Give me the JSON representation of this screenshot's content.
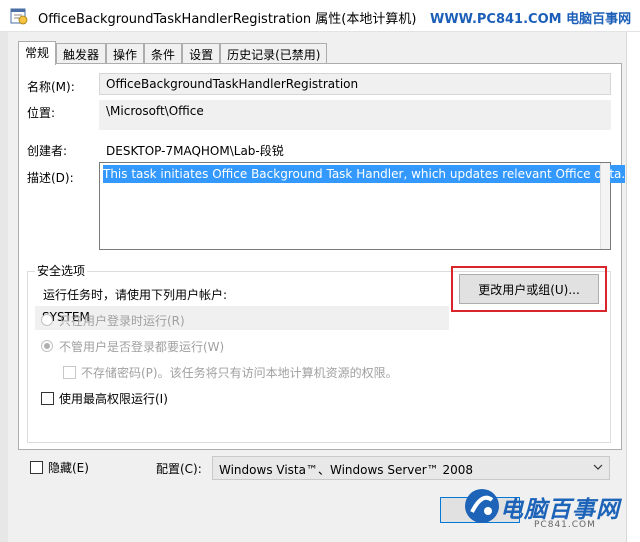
{
  "window": {
    "title": "OfficeBackgroundTaskHandlerRegistration 属性(本地计算机)",
    "watermark": "WWW.PC841.COM 电脑百事网"
  },
  "tabs": [
    {
      "label": "常规",
      "active": true
    },
    {
      "label": "触发器",
      "active": false
    },
    {
      "label": "操作",
      "active": false
    },
    {
      "label": "条件",
      "active": false
    },
    {
      "label": "设置",
      "active": false
    },
    {
      "label": "历史记录(已禁用)",
      "active": false
    }
  ],
  "general": {
    "name_label": "名称(M):",
    "name_value": "OfficeBackgroundTaskHandlerRegistration",
    "location_label": "位置:",
    "location_value": "\\Microsoft\\Office",
    "author_label": "创建者:",
    "author_value": "DESKTOP-7MAQHOM\\Lab-段锐",
    "description_label": "描述(D):",
    "description_value": "This task initiates Office Background Task Handler, which updates relevant Office data."
  },
  "security": {
    "group_label": "安全选项",
    "run_as_label": "运行任务时，请使用下列用户帐户:",
    "user_account": "SYSTEM",
    "change_user_button": "更改用户或组(U)...",
    "radio_logged_on_only": "只在用户登录时运行(R)",
    "radio_whether_logged_on": "不管用户是否登录都要运行(W)",
    "checkbox_no_store_password": "不存储密码(P)。该任务将只有访问本地计算机资源的权限。",
    "checkbox_highest_privileges": "使用最高权限运行(I)"
  },
  "footer": {
    "hidden_label": "隐藏(E)",
    "configure_label": "配置(C):",
    "configure_value": "Windows Vista™、Windows Server™ 2008"
  },
  "brand_logo": {
    "text": "电脑百事网",
    "sub": "PC841.COM"
  },
  "colors": {
    "selection": "#3399ff",
    "highlight_frame": "#d9262b",
    "watermark": "#1c5fb8"
  }
}
